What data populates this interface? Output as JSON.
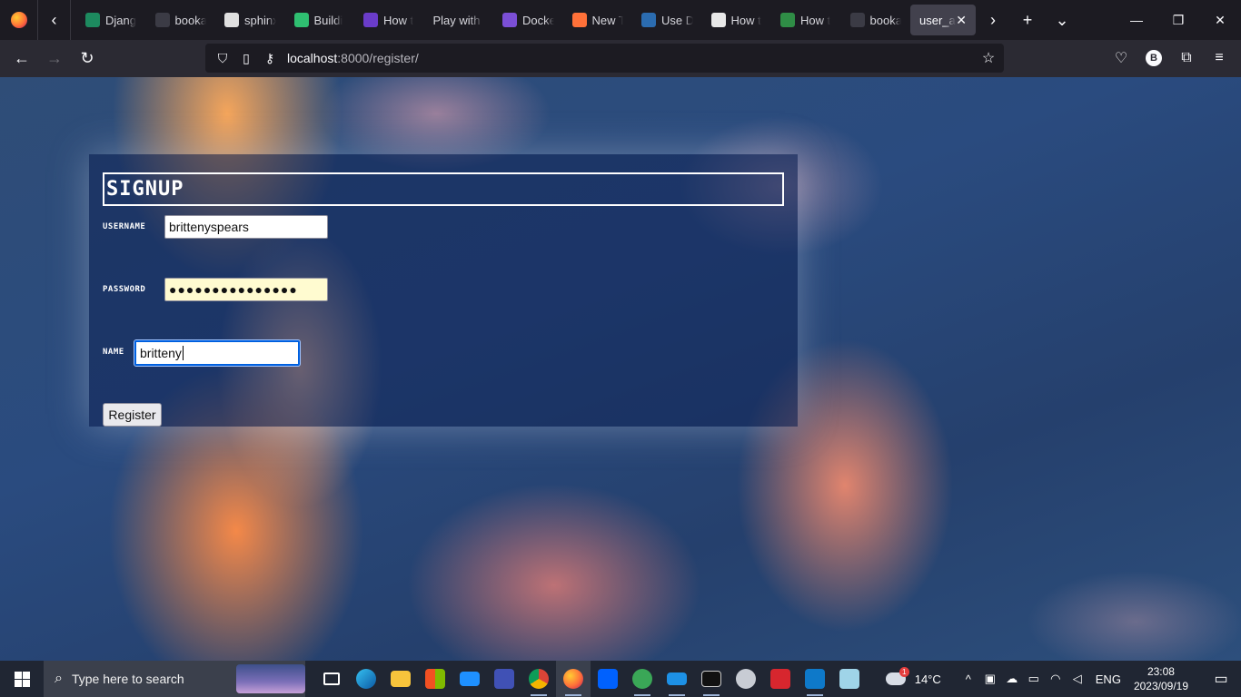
{
  "browser": {
    "tabs": [
      {
        "title": "Djang",
        "icon": "w-icon",
        "color": "#1d8a5f"
      },
      {
        "title": "booka",
        "icon": "github-icon",
        "color": "#3b3b45"
      },
      {
        "title": "sphinx",
        "icon": "cube-icon",
        "color": "#e0e0e0"
      },
      {
        "title": "Buildi",
        "icon": "play-icon",
        "color": "#2fbf71"
      },
      {
        "title": "How t",
        "icon": "doc-icon",
        "color": "#6a3cc9"
      },
      {
        "title": "Play with I",
        "icon": "",
        "color": ""
      },
      {
        "title": "Docke",
        "icon": "a-icon",
        "color": "#7b4fd6"
      },
      {
        "title": "New T",
        "icon": "firefox-icon",
        "color": "#ff7139"
      },
      {
        "title": "Use D",
        "icon": "circle-icon",
        "color": "#2b6cb0"
      },
      {
        "title": "How t",
        "icon": "chart-icon",
        "color": "#e8e8e8"
      },
      {
        "title": "How t",
        "icon": "gfg-icon",
        "color": "#2f8d46"
      },
      {
        "title": "booka",
        "icon": "github-icon",
        "color": "#3b3b45"
      }
    ],
    "active_tab": {
      "title": "user_au",
      "close": "✕"
    },
    "new_tab": "+",
    "url_host": "localhost",
    "url_rest": ":8000/register/",
    "account_initial": "B"
  },
  "page": {
    "title": "SIGNUP",
    "fields": {
      "username_label": "USERNAME",
      "username_value": "brittenyspears",
      "password_label": "PASSWORD",
      "password_value": "●●●●●●●●●●●●●●●",
      "name_label": "NAME",
      "name_value": "britteny"
    },
    "register_label": "Register"
  },
  "taskbar": {
    "search_placeholder": "Type here to search",
    "weather_temp": "14°C",
    "weather_badge": "1",
    "language": "ENG",
    "time": "23:08",
    "date": "2023/09/19"
  }
}
